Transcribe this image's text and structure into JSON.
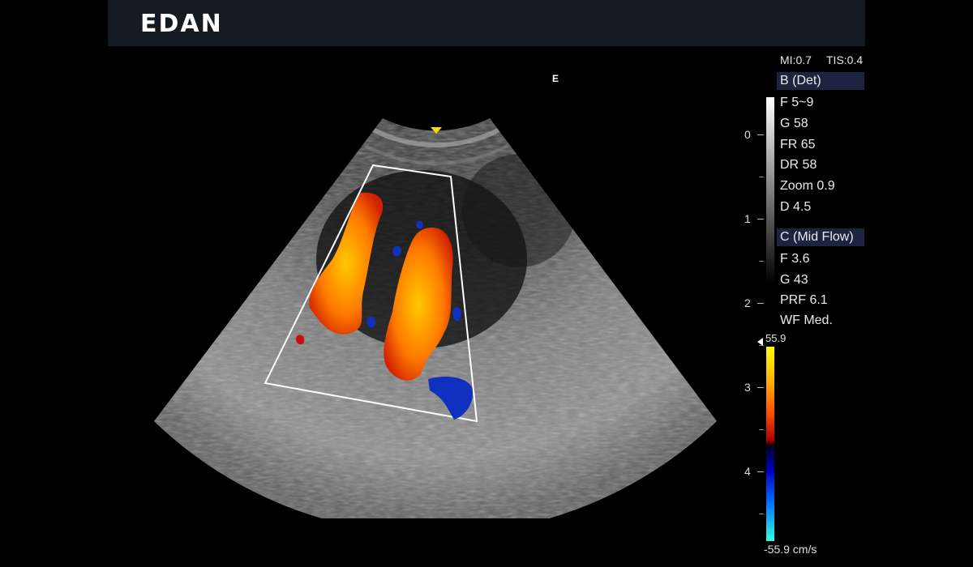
{
  "header": {
    "brand": "EDAN"
  },
  "image": {
    "orientation_mark": "E"
  },
  "safety": {
    "mi": "MI:0.7",
    "tis": "TIS:0.4"
  },
  "b_mode": {
    "title": "B (Det)",
    "params": [
      "F 5~9",
      "G 58",
      "FR 65",
      "DR 58",
      "Zoom 0.9",
      "D 4.5"
    ]
  },
  "c_mode": {
    "title": "C (Mid Flow)",
    "params": [
      "F 3.6",
      "G 43",
      "PRF 6.1",
      "WF Med."
    ]
  },
  "depth_scale": {
    "labels": [
      "0",
      "1",
      "2",
      "3",
      "4"
    ]
  },
  "color_scale": {
    "max": "55.9",
    "min": "-55.9 cm/s"
  },
  "colors": {
    "header_bg": "#141a22",
    "mode_header_bg": "#1c2440",
    "roi_box": "#ffffff",
    "probe_marker": "#f0e000"
  }
}
